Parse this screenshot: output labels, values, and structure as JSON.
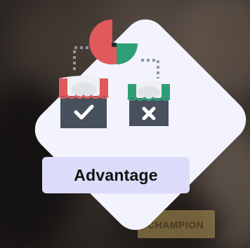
{
  "background": {
    "product_box_text": "CHAMPION"
  },
  "card": {
    "title": "Advantage",
    "colors": {
      "card": "#f3f3fe",
      "pill": "#dcdcfa",
      "red": "#e05a5c",
      "green": "#2f9e76",
      "store_body": "#47505c",
      "awning_light": "#eef0f3",
      "dotted_line": "#8f96a3"
    },
    "icons": {
      "left_store": "store-check-icon",
      "right_store": "store-x-icon",
      "pie": "pie-chart-icon"
    }
  }
}
